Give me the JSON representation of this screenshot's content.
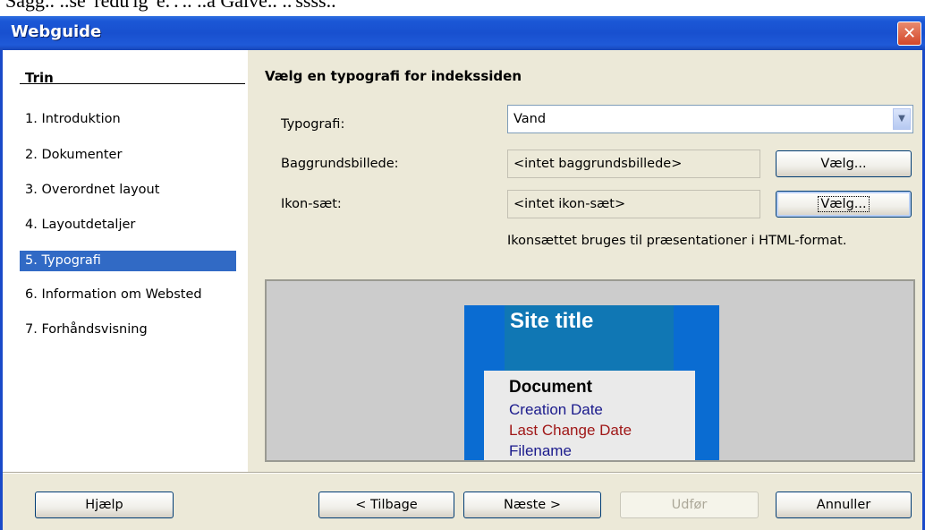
{
  "top_fragment": "Sagg.. ..se 'redu'ig 'e.'.'.. ..a Galve.. ..'ssss..",
  "window": {
    "title": "Webguide",
    "close_glyph": "✕"
  },
  "sidebar": {
    "header": "Trin",
    "steps": [
      {
        "label": "1.  Introduktion"
      },
      {
        "label": "2.  Dokumenter"
      },
      {
        "label": "3.  Overordnet layout"
      },
      {
        "label": "4.  Layoutdetaljer"
      },
      {
        "label": "5.  Typografi",
        "active": true
      },
      {
        "label": "6.  Information om Websted"
      },
      {
        "label": "7.  Forhåndsvisning"
      }
    ]
  },
  "main": {
    "heading": "Vælg en typografi for indekssiden",
    "typografi": {
      "label": "Typografi:",
      "value": "Vand"
    },
    "baggrund": {
      "label": "Baggrundsbillede:",
      "value": "<intet baggrundsbillede>",
      "button": "Vælg..."
    },
    "ikon": {
      "label": "Ikon-sæt:",
      "value": "<intet ikon-sæt>",
      "button": "Vælg..."
    },
    "hint": "Ikonsættet bruges til præsentationer i HTML-format."
  },
  "preview": {
    "site_title": "Site title",
    "document": "Document",
    "creation_date": "Creation Date",
    "last_change_date": "Last Change Date",
    "filename": "Filename",
    "colors": {
      "outer": "#0a6cd2",
      "title_band": "#1077b4",
      "doc_bg": "#eaeaea",
      "navy_text": "#1a1a8c",
      "red_text": "#a01818"
    }
  },
  "footer": {
    "help": "Hjælp",
    "back": "< Tilbage",
    "next": "Næste >",
    "finish": "Udfør",
    "cancel": "Annuller"
  }
}
